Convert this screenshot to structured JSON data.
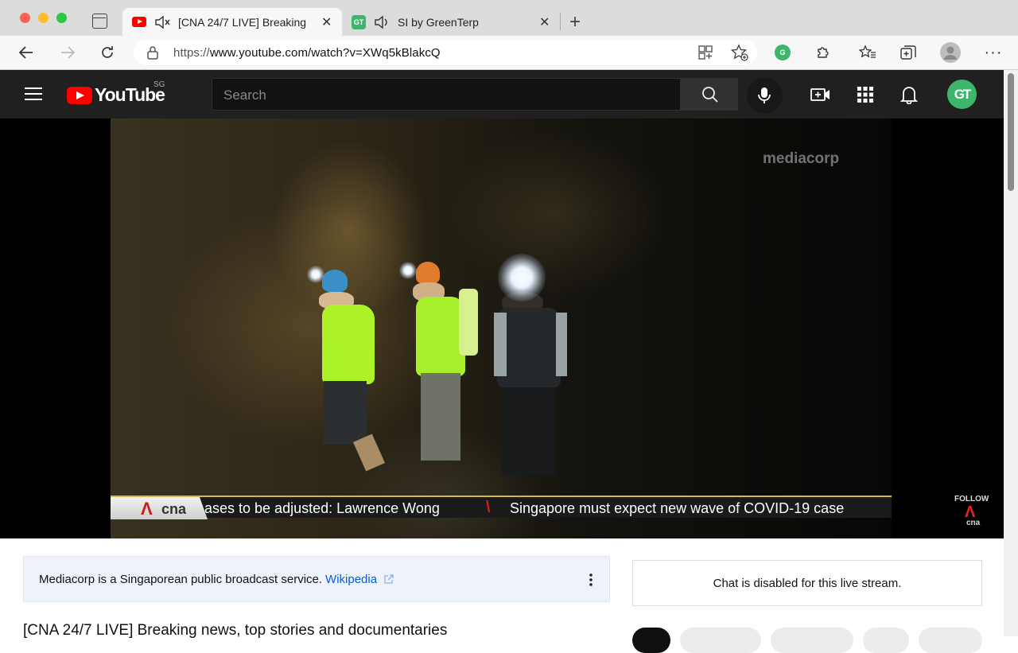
{
  "browser": {
    "tabs": [
      {
        "title": "[CNA 24/7 LIVE] Breaking",
        "favicon": "youtube-icon",
        "audio": "muted-speaker-icon",
        "active": true
      },
      {
        "title": "SI by GreenTerp",
        "favicon": "greenterp-icon",
        "audio": "speaker-icon",
        "active": false
      }
    ],
    "address_bar": {
      "scheme": "https://",
      "host_path": "www.youtube.com/watch?v=XWq5kBlakcQ"
    }
  },
  "youtube": {
    "logo_text": "YouTube",
    "country_code": "SG",
    "search_placeholder": "Search",
    "avatar_initials": "GT"
  },
  "video": {
    "watermark": "mediacorp",
    "ticker": {
      "brand": "cna",
      "headline_1": "ases to be adjusted: Lawrence Wong",
      "headline_2": "Singapore must expect new wave of COVID-19 case"
    },
    "follow_label": "FOLLOW",
    "follow_brand": "cna"
  },
  "info_panel": {
    "text": "Mediacorp is a Singaporean public broadcast service.",
    "link": "Wikipedia"
  },
  "chat": {
    "message": "Chat is disabled for this live stream."
  },
  "title": "[CNA 24/7 LIVE] Breaking news, top stories and documentaries",
  "colors": {
    "youtube_red": "#ff0000",
    "header_bg": "#202020",
    "link": "#065fd4",
    "greenterp": "#3db56b"
  }
}
